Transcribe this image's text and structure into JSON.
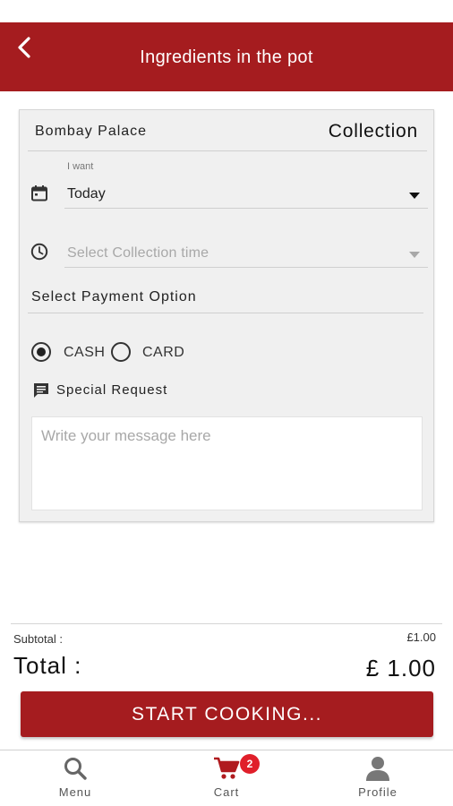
{
  "header": {
    "title": "Ingredients in the pot",
    "back_icon": "chevron-left-icon",
    "background": "#a51c1f"
  },
  "order": {
    "restaurant": "Bombay Palace",
    "order_type": "Collection",
    "date_label": "I want",
    "date_value": "Today",
    "time_placeholder": "Select Collection time",
    "payment_label": "Select Payment Option",
    "payment_options": [
      {
        "label": "CASH",
        "selected": true
      },
      {
        "label": "CARD",
        "selected": false
      }
    ],
    "special_request_label": "Special Request",
    "message_placeholder": "Write your message here"
  },
  "totals": {
    "subtotal_label": "Subtotal :",
    "subtotal_value": "£1.00",
    "total_label": "Total :",
    "total_value": "£ 1.00"
  },
  "cta": {
    "label": "START COOKING...",
    "color": "#a51c1f"
  },
  "nav": {
    "items": [
      {
        "label": "Menu",
        "icon": "search-icon"
      },
      {
        "label": "Cart",
        "icon": "cart-icon",
        "badge": "2"
      },
      {
        "label": "Profile",
        "icon": "person-icon"
      }
    ],
    "badge_color": "#e01f2a"
  }
}
